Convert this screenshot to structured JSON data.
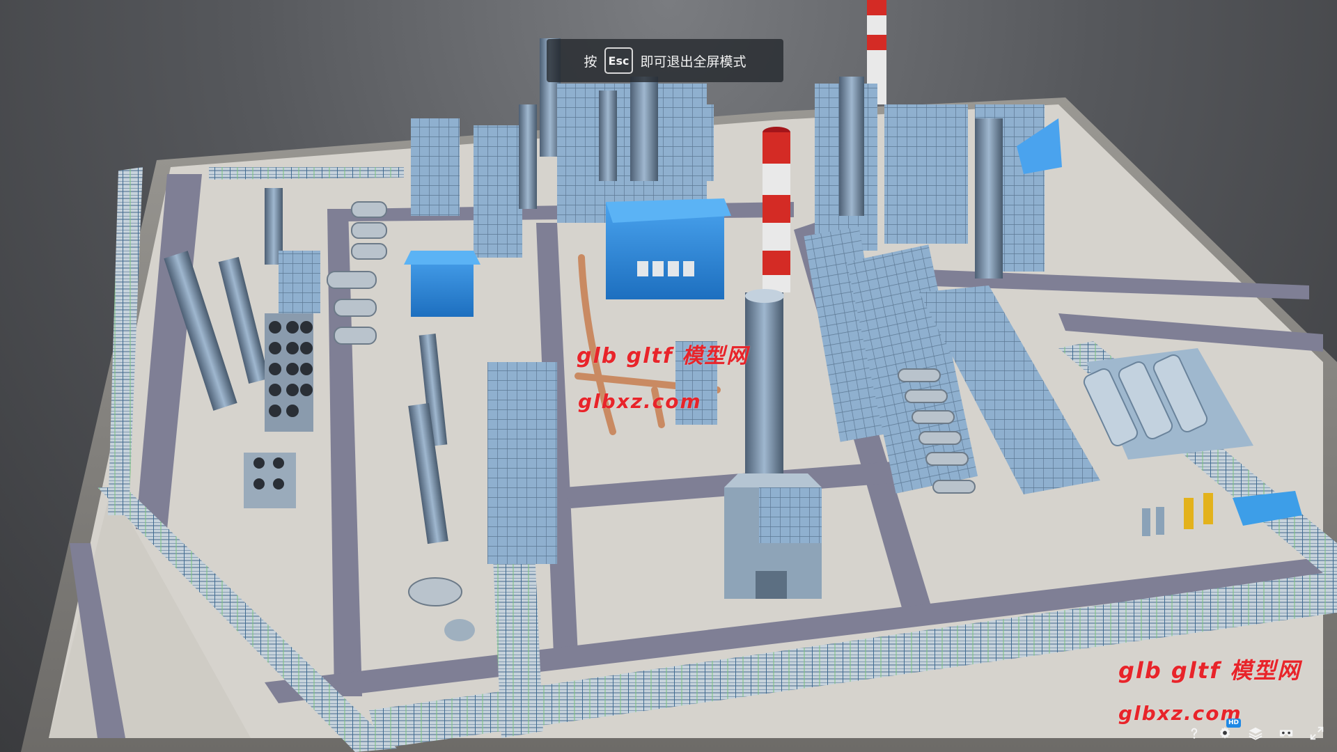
{
  "fullscreen_hint": {
    "prefix": "按",
    "key": "Esc",
    "suffix": "即可退出全屏模式"
  },
  "watermarks": {
    "line1": "glb gltf 模型网",
    "line2": "glbxz.com"
  },
  "toolbar": {
    "help_icon": "question-mark-icon",
    "settings_icon": "gear-icon",
    "hd_badge": "HD",
    "layers_icon": "layers-icon",
    "vr_icon": "vr-headset-icon",
    "fullscreen_icon": "fullscreen-icon"
  },
  "colors": {
    "background": "#4f5155",
    "ground": "#d6d3cd",
    "road": "#7f7f95",
    "steel_blue": "#7ea6c9",
    "roof_blue": "#2f86d6",
    "chimney_red": "#d42b25",
    "watermark": "#e8242a"
  }
}
